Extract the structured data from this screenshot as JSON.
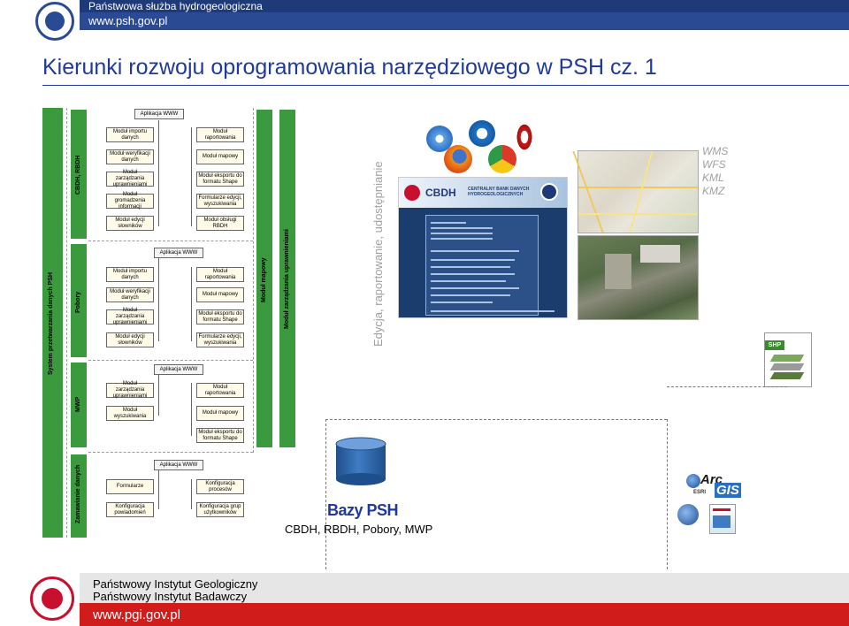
{
  "header": {
    "org": "Państwowa służba hydrogeologiczna",
    "url": "www.psh.gov.pl"
  },
  "title": "Kierunki rozwoju oprogramowania narzędziowego w PSH cz. 1",
  "diagram": {
    "system_label": "System przetwarzania danych PSH",
    "sections": [
      {
        "name": "CBDH, RBDH",
        "app": "Aplikacja WWW",
        "left": [
          "Moduł importu danych",
          "Moduł weryfikacji danych",
          "Moduł zarządzania uprawnieniami",
          "Moduł gromadzenia informacji",
          "Moduł edycji słowników"
        ],
        "right": [
          "Moduł raportowania",
          "Moduł mapowy",
          "Moduł eksportu do formatu Shape",
          "Formularze edycji, wyszukiwania",
          "Moduł obsługi RBDH"
        ]
      },
      {
        "name": "Pobory",
        "app": "Aplikacja WWW",
        "left": [
          "Moduł importu danych",
          "Moduł weryfikacji danych",
          "Moduł zarządzania uprawnieniami",
          "Moduł edycji słowników"
        ],
        "right": [
          "Moduł raportowania",
          "Moduł mapowy",
          "Moduł eksportu do formatu Shape",
          "Formularze edycji, wyszukiwania"
        ]
      },
      {
        "name": "MWP",
        "app": "Aplikacja WWW",
        "left": [
          "Moduł zarządzania uprawnieniami",
          "Moduł wyszukiwania"
        ],
        "right": [
          "Moduł raportowania",
          "Moduł mapowy",
          "Moduł eksportu do formatu Shape"
        ]
      },
      {
        "name": "Zamawianie danych",
        "app": "Aplikacja WWW",
        "left": [
          "Formularze",
          "Konfiguracja powiadomień"
        ],
        "right": [
          "Konfiguracja procesów",
          "Konfiguracja grup użytkowników"
        ]
      }
    ],
    "top_app": "Aplikacja WWW",
    "shared_modules": [
      "Moduł mapowy",
      "Moduł zarządzania uprawnieniami"
    ]
  },
  "vertical_caption": "Edycja, raportowanie, udostępnianie",
  "screenshot": {
    "brand": "CBDH",
    "brand_sub": "CENTRALNY BANK DANYCH HYDROGEOLOGICZNYCH"
  },
  "formats": [
    "WMS",
    "WFS",
    "KML",
    "KMZ"
  ],
  "shp_label": "SHP",
  "arcgis": {
    "arc": "Arc",
    "gis": "GIS",
    "esri": "ESRI"
  },
  "database": {
    "label": "Bazy PSH",
    "sub": "CBDH, RBDH, Pobory, MWP"
  },
  "footer": {
    "line1": "Państwowy Instytut Geologiczny",
    "line2": "Państwowy Instytut Badawczy",
    "url": "www.pgi.gov.pl"
  },
  "colors": {
    "header_blue": "#2a4a93",
    "title_blue": "#1f3a9a",
    "green_bar": "#3c9a3e",
    "footer_red": "#d11c1c"
  }
}
